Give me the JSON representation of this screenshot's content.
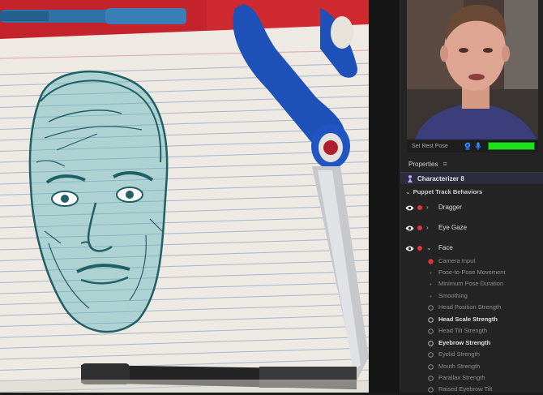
{
  "scene": {
    "description": "",
    "paper_color": "#eeeae3",
    "line_color": "#8ca7c6",
    "ink_color": "#1f5f66",
    "face_fill": "#5fb6ba"
  },
  "camera": {
    "set_rest_pose": "Set Rest Pose",
    "icons": [
      "webcam-icon",
      "microphone-icon"
    ],
    "audio_level": 1.0,
    "accent": "#1c66b4"
  },
  "properties": {
    "title": "Properties",
    "menu_icon": "≡",
    "puppet_name": "Characterizer 8",
    "section_label": "Puppet Track Behaviors",
    "behaviors": [
      {
        "label": "Dragger",
        "expanded": false
      },
      {
        "label": "Eye Gaze",
        "expanded": false
      },
      {
        "label": "Face",
        "expanded": true
      }
    ],
    "face_params": [
      {
        "label": "Camera Input",
        "style": "record"
      },
      {
        "label": "Pose-to-Pose Movement",
        "style": "dot"
      },
      {
        "label": "Minimum Pose Duration",
        "style": "dot"
      },
      {
        "label": "Smoothing",
        "style": "dot"
      },
      {
        "label": "Head Position Strength",
        "style": "ring"
      },
      {
        "label": "Head Scale Strength",
        "style": "ring-bold"
      },
      {
        "label": "Head Tilt Strength",
        "style": "ring"
      },
      {
        "label": "Eyebrow Strength",
        "style": "ring-bold"
      },
      {
        "label": "Eyelid Strength",
        "style": "ring"
      },
      {
        "label": "Mouth Strength",
        "style": "ring"
      },
      {
        "label": "Parallax Strength",
        "style": "ring"
      },
      {
        "label": "Raised Eyebrow Tilt",
        "style": "ring"
      }
    ]
  }
}
